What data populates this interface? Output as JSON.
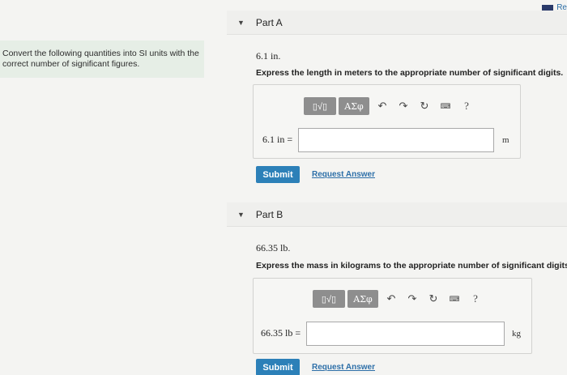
{
  "header": {
    "top_link": "Re"
  },
  "instructions": "Convert the following quantities into SI units with the correct number of significant figures.",
  "toolbar": {
    "template_label": "▯√▯",
    "greek_label": "ΑΣφ",
    "undo_icon": "↶",
    "redo_icon": "↷",
    "reset_icon": "↻",
    "keyboard_icon": "⌨",
    "help_icon": "?"
  },
  "parts": [
    {
      "title": "Part A",
      "quantity": "6.1 in",
      "quantity_suffix": ".",
      "instruction": "Express the length in meters to the appropriate number of significant digits.",
      "answer_label": "6.1 in =",
      "answer_value": "",
      "unit": "m",
      "submit_label": "Submit",
      "request_label": "Request Answer"
    },
    {
      "title": "Part B",
      "quantity": "66.35 lb",
      "quantity_suffix": ".",
      "instruction": "Express the mass in kilograms to the appropriate number of significant digits.",
      "answer_label": "66.35 lb =",
      "answer_value": "",
      "unit": "kg",
      "submit_label": "Submit",
      "request_label": "Request Answer"
    }
  ]
}
